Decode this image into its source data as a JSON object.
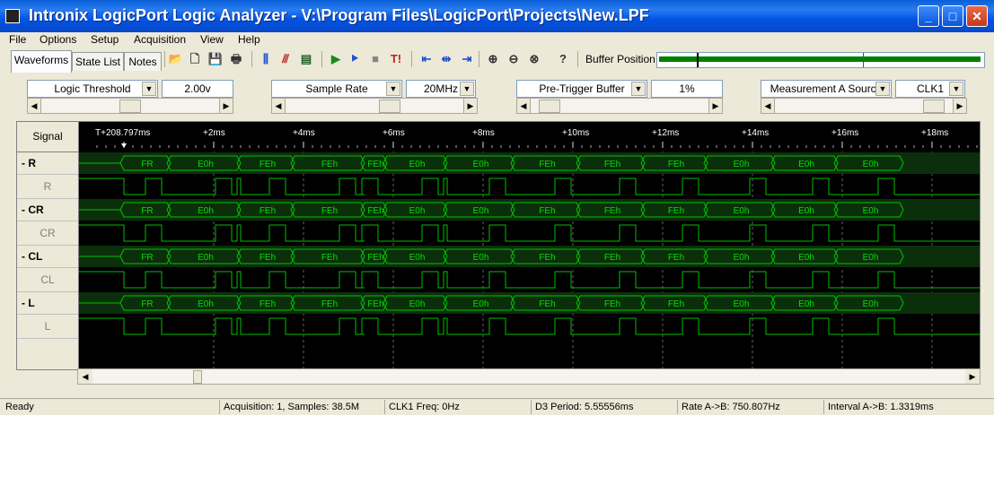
{
  "window": {
    "title": "Intronix LogicPort Logic Analyzer - V:\\Program Files\\LogicPort\\Projects\\New.LPF",
    "buttons": {
      "minimize": "_",
      "maximize": "□",
      "close": "✕"
    }
  },
  "menu": [
    "File",
    "Options",
    "Setup",
    "Acquisition",
    "View",
    "Help"
  ],
  "tabs": [
    "Waveforms",
    "State List",
    "Notes"
  ],
  "toolbar": {
    "icons": [
      "open-folder-icon",
      "new-file-icon",
      "save-icon",
      "print-icon",
      "channels-icon",
      "trigger-icon",
      "grid-icon",
      "run-icon",
      "run-repeat-icon",
      "stop-icon",
      "trigger-now-icon",
      "go-start-icon",
      "center-icon",
      "go-end-icon",
      "zoom-in-icon",
      "zoom-out-icon",
      "zoom-fit-icon",
      "help-icon"
    ],
    "glyphs": [
      "📂",
      "🗋",
      "💾",
      "🖶",
      "⫼",
      "⫻",
      "▤",
      "▶",
      "⯈",
      "■",
      "T!",
      "⇤",
      "⇹",
      "⇥",
      "⊕",
      "⊖",
      "⊗",
      "?"
    ],
    "buffer_position_label": "Buffer Position:",
    "buffer_position": {
      "view_marker": 0.12,
      "trigger_marker": 0.63
    }
  },
  "controls": {
    "threshold": {
      "label": "Logic Threshold",
      "value": "2.00v",
      "slider": 0.5
    },
    "sample_rate": {
      "label": "Sample Rate",
      "value": "20MHz",
      "slider": 0.6
    },
    "pretrigger": {
      "label": "Pre-Trigger Buffer",
      "value": "1%",
      "slider": 0.05
    },
    "measurement": {
      "label": "Measurement A Source",
      "value": "CLK1",
      "slider": 0.95
    }
  },
  "waveform": {
    "signal_header": "Signal",
    "time_labels": [
      "T+208.797ms",
      "+2ms",
      "+4ms",
      "+6ms",
      "+8ms",
      "+10ms",
      "+12ms",
      "+14ms",
      "+16ms",
      "+18ms"
    ],
    "signals": [
      {
        "name": "- R",
        "type": "bus"
      },
      {
        "name": "R",
        "type": "bit"
      },
      {
        "name": "- CR",
        "type": "bus"
      },
      {
        "name": "CR",
        "type": "bit"
      },
      {
        "name": "- CL",
        "type": "bus"
      },
      {
        "name": "CL",
        "type": "bit"
      },
      {
        "name": "- L",
        "type": "bus"
      },
      {
        "name": "L",
        "type": "bit"
      }
    ],
    "bus_values": [
      "FR",
      "E0h",
      "FEh",
      "FEh",
      "FEh",
      "E0h",
      "E0h",
      "FEh",
      "FEh",
      "FEh",
      "E0h",
      "E0h",
      "E0h"
    ],
    "colors": {
      "wave": "#00c000",
      "bus_band": "#0b2f0b",
      "grid": "#606060",
      "text": "#00e000"
    }
  },
  "status": {
    "ready": "Ready",
    "acquisition": "Acquisition: 1, Samples: 38.5M",
    "clk1_freq": "CLK1 Freq: 0Hz",
    "d3_period": "D3 Period: 5.55556ms",
    "rate": "Rate A->B: 750.807Hz",
    "interval": "Interval A->B: 1.3319ms"
  }
}
